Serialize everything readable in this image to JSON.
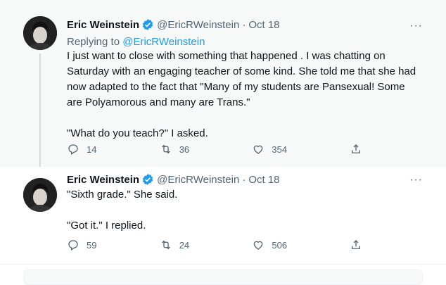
{
  "tweets": [
    {
      "author_name": "Eric Weinstein",
      "handle": "@EricRWeinstein",
      "separator": "·",
      "date": "Oct 18",
      "more_label": "···",
      "replying_prefix": "Replying to ",
      "replying_handle": "@EricRWeinstein",
      "text": "I just want to close with something that happened . I was chatting on\nSaturday with an engaging teacher of some kind. She told me that she had\nnow adapted to the fact that \"Many of my students are Pansexual! Some\nare Polyamorous and many are Trans.\"\n\n\"What do you teach?\" I asked.",
      "replies": "14",
      "retweets": "36",
      "likes": "354"
    },
    {
      "author_name": "Eric Weinstein",
      "handle": "@EricRWeinstein",
      "separator": "·",
      "date": "Oct 18",
      "more_label": "···",
      "text": "\"Sixth grade.\" She said.\n\n\"Got it.\" I replied.",
      "replies": "59",
      "retweets": "24",
      "likes": "506"
    }
  ],
  "colors": {
    "verified": "#1d9bf0",
    "link": "#1d9bf0",
    "secondary_text": "#536471"
  },
  "icons": [
    "verified-badge-icon",
    "more-icon",
    "reply-icon",
    "retweet-icon",
    "like-icon",
    "share-icon"
  ]
}
